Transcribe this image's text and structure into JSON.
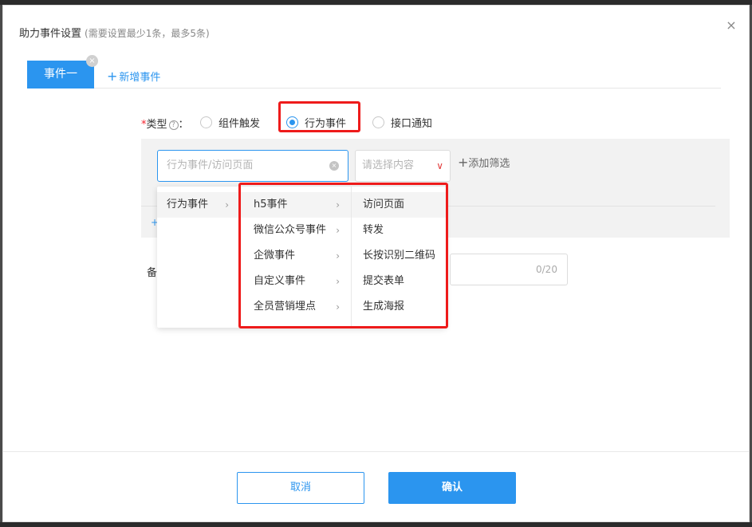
{
  "dialog": {
    "title": "助力事件设置",
    "subtitle": "(需要设置最少1条，最多5条)",
    "close_icon": "×"
  },
  "tabs": {
    "active_label": "事件一",
    "remove_icon": "×",
    "add_icon": "+",
    "add_label": "新增事件"
  },
  "type_field": {
    "required_mark": "*",
    "label": "类型",
    "help_icon": "?",
    "colon": "：",
    "options": [
      {
        "label": "组件触发",
        "checked": false
      },
      {
        "label": "行为事件",
        "checked": true
      },
      {
        "label": "接口通知",
        "checked": false
      }
    ]
  },
  "filter": {
    "event_placeholder": "行为事件/访问页面",
    "clear_icon": "×",
    "content_placeholder": "请选择内容",
    "dropdown_arrow": "∨",
    "add_filter_icon": "+",
    "add_filter_label": "添加筛选",
    "add_row_icon": "+"
  },
  "remark": {
    "label": "备",
    "counter": "0/20"
  },
  "cascader": {
    "level1": [
      {
        "label": "行为事件",
        "chevron": "›"
      }
    ],
    "level2": [
      {
        "label": "h5事件",
        "chevron": "›"
      },
      {
        "label": "微信公众号事件",
        "chevron": "›"
      },
      {
        "label": "企微事件",
        "chevron": "›"
      },
      {
        "label": "自定义事件",
        "chevron": "›"
      },
      {
        "label": "全员营销埋点",
        "chevron": "›"
      }
    ],
    "level3": [
      {
        "label": "访问页面"
      },
      {
        "label": "转发"
      },
      {
        "label": "长按识别二维码"
      },
      {
        "label": "提交表单"
      },
      {
        "label": "生成海报"
      }
    ]
  },
  "footer": {
    "cancel_label": "取消",
    "confirm_label": "确认"
  },
  "colors": {
    "primary": "#2b95ef",
    "highlight": "#ee1b1b"
  }
}
